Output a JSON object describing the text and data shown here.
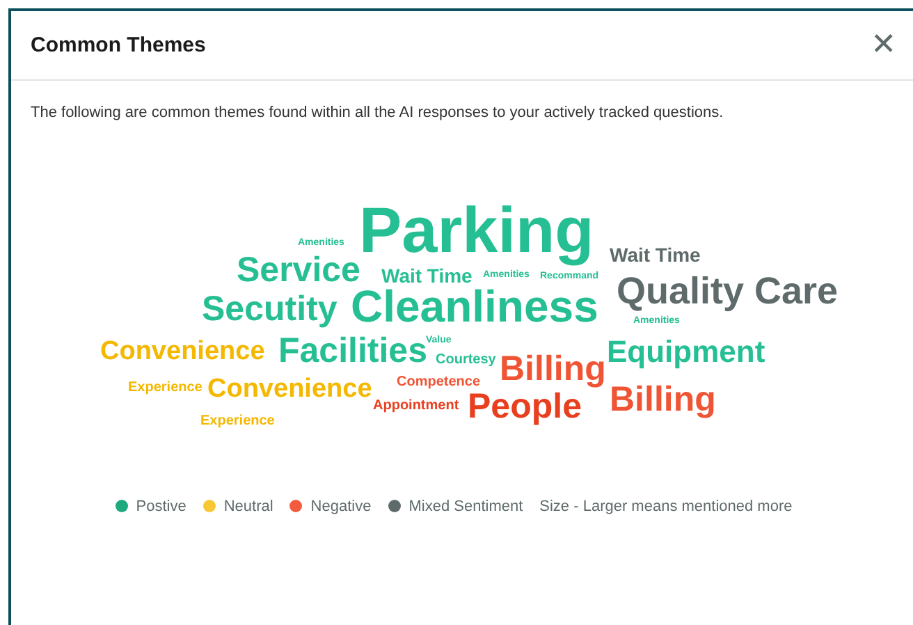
{
  "dialog": {
    "title": "Common Themes",
    "close": "✕",
    "description": "The following are common themes found within all the AI responses to your actively tracked questions."
  },
  "cloud": [
    {
      "text": "Amenities",
      "color": "#26bf94"
    },
    {
      "text": "Parking",
      "color": "#26bf94"
    },
    {
      "text": "Wait Time",
      "color": "#5f6b6b"
    },
    {
      "text": "Service",
      "color": "#26bf94"
    },
    {
      "text": "Wait Time",
      "color": "#26bf94"
    },
    {
      "text": "Amenities",
      "color": "#26bf94"
    },
    {
      "text": "Quality Care",
      "color": "#5f6b6b"
    },
    {
      "text": "Recommand",
      "color": "#26bf94"
    },
    {
      "text": "Secutity",
      "color": "#26bf94"
    },
    {
      "text": "Cleanliness",
      "color": "#26bf94"
    },
    {
      "text": "Amenities",
      "color": "#26bf94"
    },
    {
      "text": "Convenience",
      "color": "#f5b800"
    },
    {
      "text": "Facilities",
      "color": "#26bf94"
    },
    {
      "text": "Value",
      "color": "#26bf94"
    },
    {
      "text": "Courtesy",
      "color": "#26bf94"
    },
    {
      "text": "Billing",
      "color": "#ef5535"
    },
    {
      "text": "Equipment",
      "color": "#26bf94"
    },
    {
      "text": "Experience",
      "color": "#f5b800"
    },
    {
      "text": "Convenience",
      "color": "#f5b800"
    },
    {
      "text": "Competence",
      "color": "#ef5535"
    },
    {
      "text": "Appointment",
      "color": "#e83f1f"
    },
    {
      "text": "People",
      "color": "#e83f1f"
    },
    {
      "text": "Billing",
      "color": "#ef5535"
    },
    {
      "text": "Experience",
      "color": "#f5b800"
    }
  ],
  "legend": [
    {
      "label": "Postive",
      "color": "#1fa97f"
    },
    {
      "label": "Neutral",
      "color": "#f8c733"
    },
    {
      "label": "Negative",
      "color": "#f25c3e"
    },
    {
      "label": "Mixed Sentiment",
      "color": "#5f6b6b"
    }
  ],
  "legend_note": "Size - Larger means mentioned more"
}
